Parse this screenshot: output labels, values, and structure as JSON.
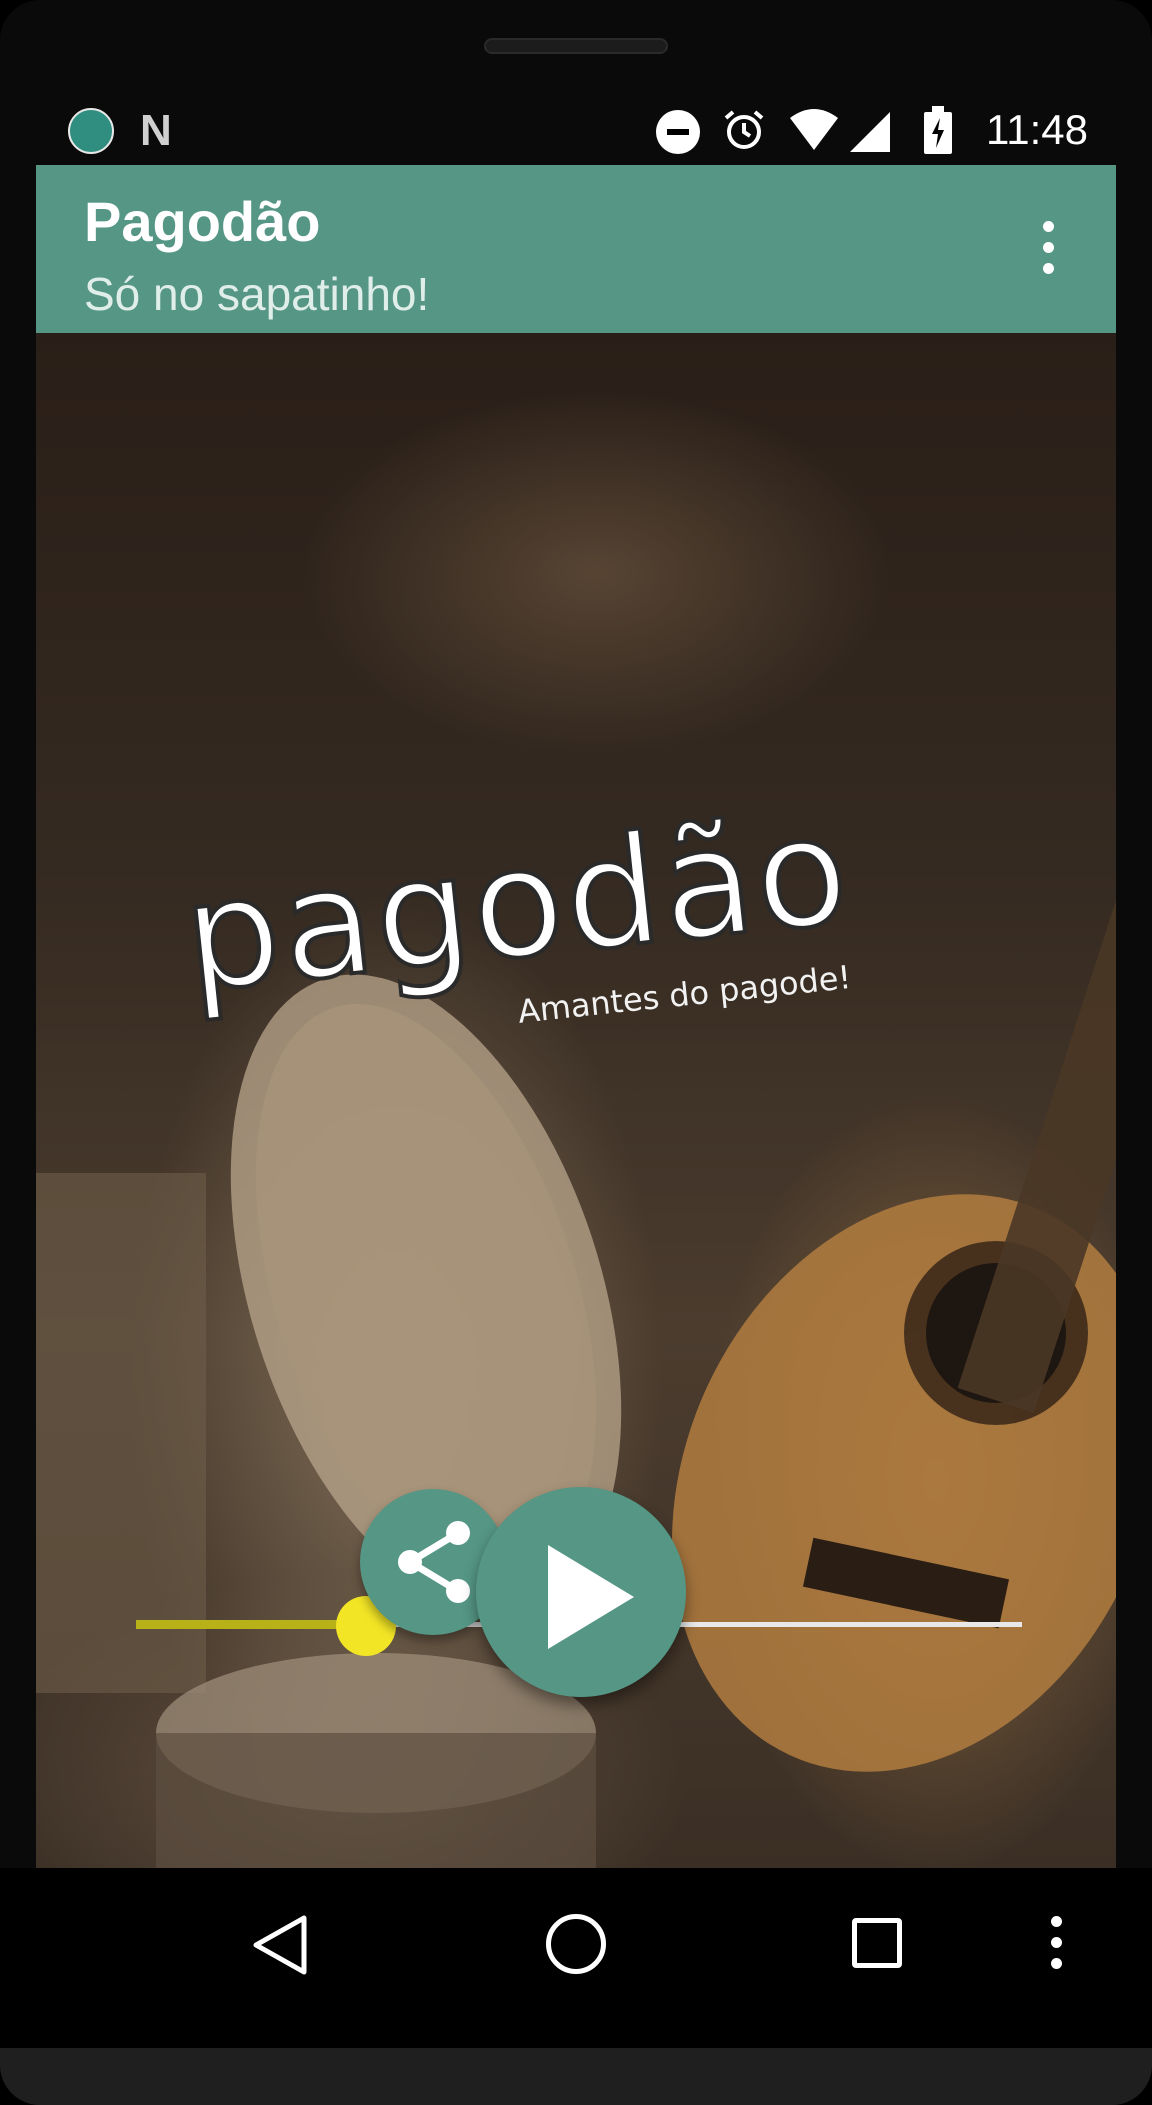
{
  "status_bar": {
    "time": "11:48",
    "icons": [
      "app-logo-icon",
      "n-icon",
      "do-not-disturb-icon",
      "alarm-icon",
      "wifi-icon",
      "signal-icon",
      "battery-charging-icon"
    ]
  },
  "app_bar": {
    "title": "Pagodão",
    "subtitle": "Só no sapatinho!",
    "menu_icon": "more-vert-icon",
    "color": "#559685"
  },
  "hero": {
    "logo_text": "pagodão",
    "tagline": "Amantes do pagode!"
  },
  "player": {
    "volume_level": 0.26,
    "volume_fill_color": "#b8b118",
    "thumb_color": "#f2e526",
    "share_icon": "share-icon",
    "play_icon": "play-icon"
  },
  "nav_bar": {
    "icons": [
      "back-icon",
      "home-icon",
      "recent-apps-icon",
      "more-vert-icon"
    ]
  }
}
